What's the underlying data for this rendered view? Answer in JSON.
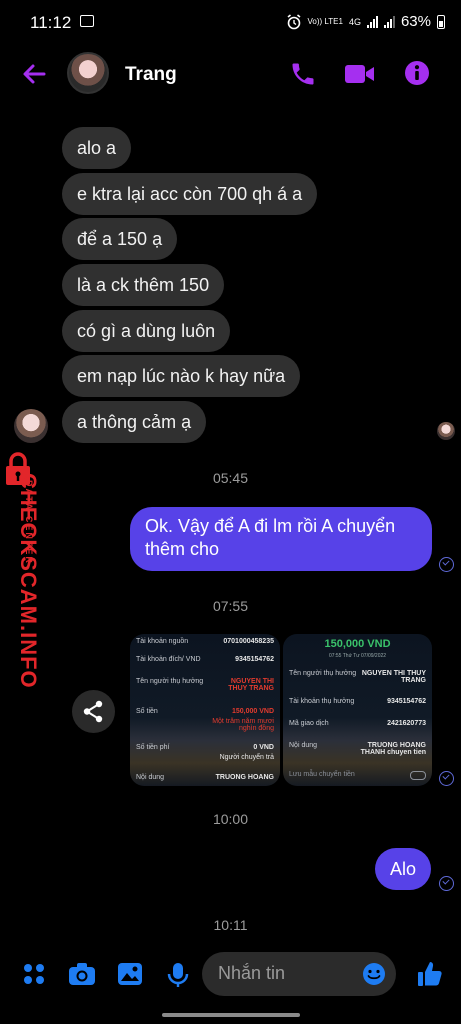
{
  "status_bar": {
    "time": "11:12",
    "network": "Vo)) LTE1",
    "network_type": "4G",
    "battery": "63%"
  },
  "header": {
    "contact_name": "Trang"
  },
  "incoming_messages": [
    "alo a",
    "e ktra lại acc còn 700 qh á a",
    "để a 150 ạ",
    "là a ck thêm 150",
    "có gì a dùng luôn",
    "em nạp lúc nào k hay nữa",
    "a thông cảm ạ"
  ],
  "timestamps": {
    "t1": "05:45",
    "t2": "07:55",
    "t3": "10:00",
    "t4": "10:11"
  },
  "outgoing_messages": {
    "reply": "Ok. Vậy để A đi lm rồi A chuyển thêm cho",
    "alo": "Alo"
  },
  "receipt_left": {
    "source_label": "Tài khoản nguồn",
    "source_value": "0701000458235",
    "dest_label": "Tài khoản đích/ VND",
    "dest_value": "9345154762",
    "recipient_label": "Tên người thụ hưởng",
    "recipient_value": "NGUYEN THI THUY TRANG",
    "amount_label": "Số tiền",
    "amount_value": "150,000 VND",
    "amount_words": "Một trăm năm mươi nghìn đồng",
    "fee_label": "Số tiền phí",
    "fee_value": "0 VND",
    "fee_payer": "Người chuyển trả",
    "content_label": "Nội dung",
    "content_value": "TRUONG HOANG"
  },
  "receipt_right": {
    "amount": "150,000 VND",
    "date": "07:55 Thứ Tư 07/09/2022",
    "recipient_label": "Tên người thụ hưởng",
    "recipient_value": "NGUYEN THI THUY TRANG",
    "account_label": "Tài khoản thụ hưởng",
    "account_value": "9345154762",
    "txn_label": "Mã giao dịch",
    "txn_value": "2421620773",
    "content_label": "Nội dung",
    "content_value": "TRUONG HOANG THANH chuyen tien",
    "save_label": "Lưu mẫu chuyển tiền"
  },
  "watermark": {
    "main": "CHECKSCAM.INFO",
    "sub": "DATA CENTER"
  },
  "composer": {
    "placeholder": "Nhắn tin"
  },
  "colors": {
    "accent": "#a52ff0",
    "outgoing": "#5742e8",
    "incoming": "#303030",
    "tool_blue": "#1e7cf2",
    "watermark": "#e2262a"
  }
}
